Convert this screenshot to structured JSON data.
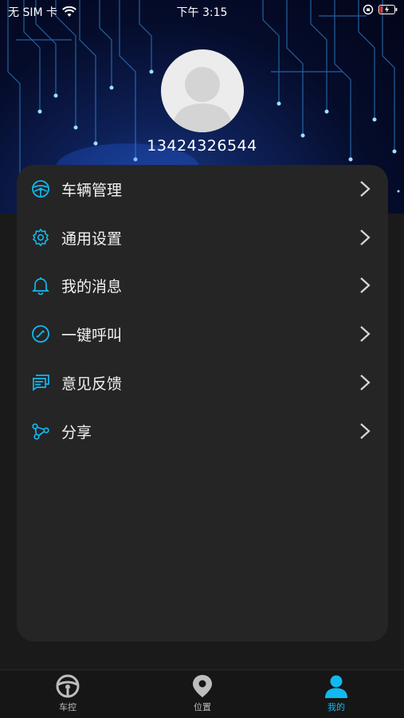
{
  "status_bar": {
    "carrier": "无 SIM 卡",
    "time": "下午 3:15"
  },
  "profile": {
    "phone": "13424326544"
  },
  "menu": {
    "items": [
      {
        "label": "车辆管理",
        "icon": "steering-wheel-icon"
      },
      {
        "label": "通用设置",
        "icon": "gear-icon"
      },
      {
        "label": "我的消息",
        "icon": "bell-icon"
      },
      {
        "label": "一键呼叫",
        "icon": "phone-call-icon"
      },
      {
        "label": "意见反馈",
        "icon": "feedback-icon"
      },
      {
        "label": "分享",
        "icon": "share-icon"
      }
    ]
  },
  "tabbar": {
    "tabs": [
      {
        "label": "车控",
        "icon": "steering-wheel-icon",
        "active": false
      },
      {
        "label": "位置",
        "icon": "location-pin-icon",
        "active": false
      },
      {
        "label": "我的",
        "icon": "person-icon",
        "active": true
      }
    ]
  },
  "colors": {
    "accent": "#12b8f0",
    "card": "#252526",
    "background": "#1a1a1b"
  }
}
